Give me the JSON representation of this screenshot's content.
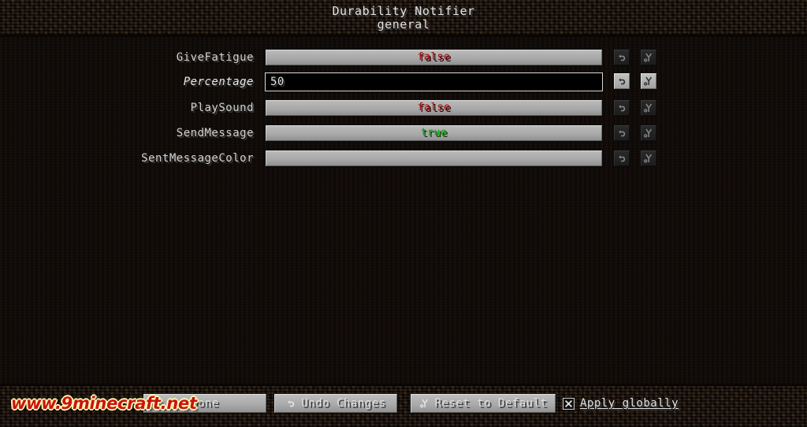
{
  "window": {
    "title": "Durability Notifier",
    "subtitle": "general"
  },
  "colors": {
    "value_true": "#00a400",
    "value_false": "#aa0000",
    "text": "#dedede",
    "button_face": "#aaaaaa",
    "watermark": "#c81414"
  },
  "rows": [
    {
      "label": "GiveFatigue",
      "type": "boolean",
      "value": "false",
      "value_state": "false",
      "modified": false,
      "undo_enabled": false,
      "reset_enabled": false
    },
    {
      "label": "Percentage",
      "type": "text",
      "value": "50",
      "placeholder": "",
      "modified": true,
      "undo_enabled": true,
      "reset_enabled": true
    },
    {
      "label": "PlaySound",
      "type": "boolean",
      "value": "false",
      "value_state": "false",
      "modified": false,
      "undo_enabled": false,
      "reset_enabled": false
    },
    {
      "label": "SendMessage",
      "type": "boolean",
      "value": "true",
      "value_state": "true",
      "modified": false,
      "undo_enabled": false,
      "reset_enabled": false
    },
    {
      "label": "SentMessageColor",
      "type": "boolean",
      "value": "",
      "value_state": "none",
      "modified": false,
      "undo_enabled": false,
      "reset_enabled": false
    }
  ],
  "row_icons": {
    "undo": "undo-arrow-icon",
    "reset": "reset-to-default-icon"
  },
  "footer": {
    "done_label": "Done",
    "undo_changes_label": "Undo Changes",
    "undo_changes_icon": "undo-arrow-icon",
    "reset_default_label": "Reset to Default",
    "reset_default_icon": "reset-to-default-icon",
    "apply_globally_label": "Apply globally",
    "apply_globally_checked": false,
    "apply_globally_mark": "x"
  },
  "watermark": {
    "text": "www.9minecraft.net"
  }
}
